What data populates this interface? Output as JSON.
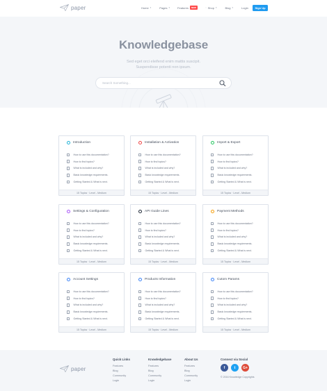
{
  "brand": {
    "name": "paper"
  },
  "nav": {
    "items": [
      {
        "label": "Home"
      },
      {
        "label": "Pages"
      },
      {
        "label": "Features",
        "badge": "NEW"
      },
      {
        "label": "Shop"
      },
      {
        "label": "Blog"
      },
      {
        "label": "Login"
      }
    ],
    "signup": "Sign Up"
  },
  "hero": {
    "title": "Knowledgebase",
    "subtitle_line1": "Sed eget orci eleifend enim mattis suscipit.",
    "subtitle_line2": "Suspendisse potenti non ipsum.",
    "search_placeholder": "Search Something..."
  },
  "card_items": [
    "How to use this documentation?",
    "How to find topics?",
    "What is included and why?",
    "Basic knowledge requirements.",
    "Getting Started & What is next."
  ],
  "card_footer": "15 Topics · Level - Medium",
  "cards": [
    {
      "title": "Introduction",
      "color": "#20b2d6"
    },
    {
      "title": "Installation & Activation",
      "color": "#ef4444"
    },
    {
      "title": "Import & Export",
      "color": "#22c55e"
    },
    {
      "title": "Settings & Configuration",
      "color": "#a855f7"
    },
    {
      "title": "API Guide Lines",
      "color": "#1f2937"
    },
    {
      "title": "Payment Methods",
      "color": "#f59e0b"
    },
    {
      "title": "Account Settings",
      "color": "#3b82f6"
    },
    {
      "title": "Products Information",
      "color": "#3b82f6"
    },
    {
      "title": "Cutom Params",
      "color": "#3b82f6"
    }
  ],
  "footer": {
    "quick": {
      "title": "Quick Links",
      "links": [
        "Features",
        "Blog",
        "Community",
        "Login"
      ]
    },
    "kb": {
      "title": "Knowledgebase",
      "links": [
        "Features",
        "Blog",
        "Community",
        "Login"
      ]
    },
    "about": {
      "title": "About Us",
      "links": [
        "Features",
        "Blog",
        "Community",
        "Login"
      ]
    },
    "connect": {
      "title": "Connect via Social",
      "socials": [
        {
          "name": "facebook-icon",
          "glyph": "f",
          "color": "#3b5998"
        },
        {
          "name": "twitter-icon",
          "glyph": "t",
          "color": "#1da1f2"
        },
        {
          "name": "google-plus-icon",
          "glyph": "G+",
          "color": "#dd4b39"
        }
      ],
      "copyright": "© 2016 Knowledge Copyrights"
    }
  }
}
